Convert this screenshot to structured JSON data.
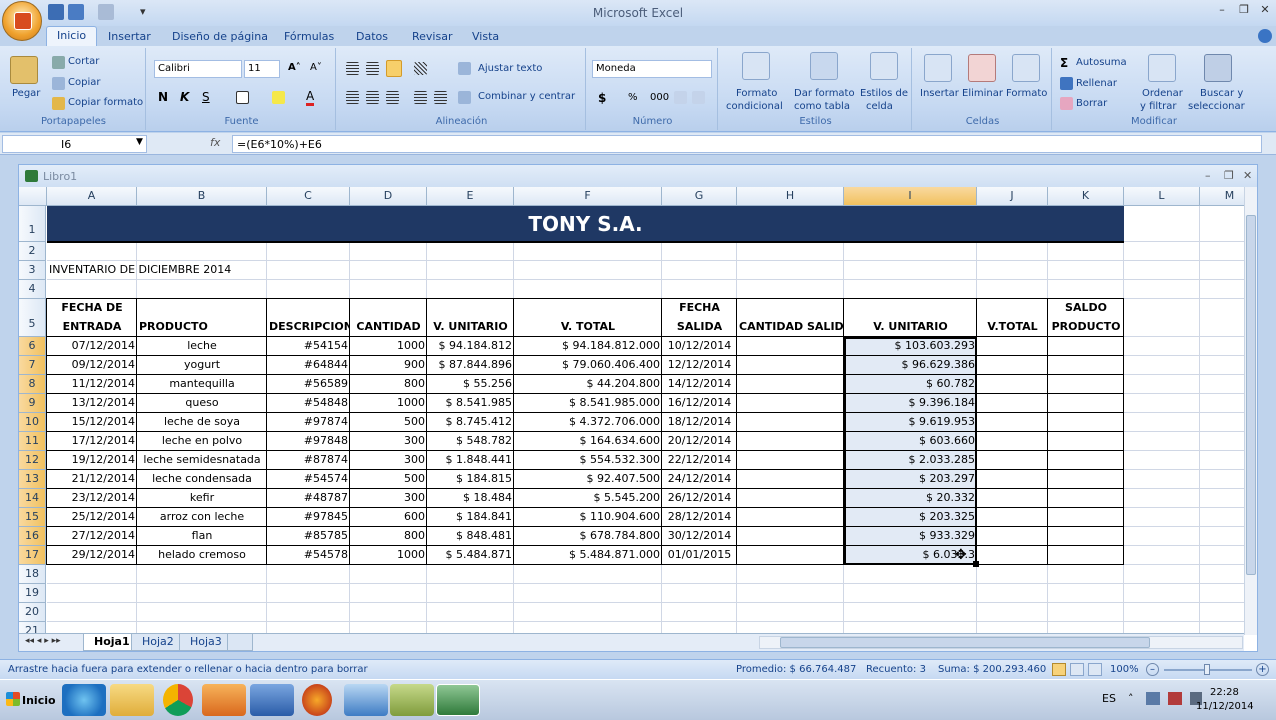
{
  "titlebar": {
    "app_title": "Microsoft Excel"
  },
  "tabs": [
    {
      "label": "Inicio"
    },
    {
      "label": "Insertar"
    },
    {
      "label": "Diseño de página"
    },
    {
      "label": "Fórmulas"
    },
    {
      "label": "Datos"
    },
    {
      "label": "Revisar"
    },
    {
      "label": "Vista"
    }
  ],
  "ribbon": {
    "portapapeles": {
      "label": "Portapapeles",
      "pegar": "Pegar",
      "cortar": "Cortar",
      "copiar": "Copiar",
      "copiar_formato": "Copiar formato"
    },
    "fuente": {
      "label": "Fuente",
      "font_name": "Calibri",
      "font_size": "11"
    },
    "alineacion": {
      "label": "Alineación",
      "ajustar_texto": "Ajustar texto",
      "combinar": "Combinar y centrar"
    },
    "numero": {
      "label": "Número",
      "format": "Moneda",
      "currency": "$",
      "percent": "%",
      "thousands": "000"
    },
    "estilos": {
      "label": "Estilos",
      "formato_condicional_1": "Formato",
      "formato_condicional_2": "condicional",
      "dar_formato_1": "Dar formato",
      "dar_formato_2": "como tabla",
      "estilos_celda_1": "Estilos de",
      "estilos_celda_2": "celda"
    },
    "celdas": {
      "label": "Celdas",
      "insertar": "Insertar",
      "eliminar": "Eliminar",
      "formato": "Formato"
    },
    "modificar": {
      "label": "Modificar",
      "autosuma": "Autosuma",
      "rellenar": "Rellenar",
      "borrar": "Borrar",
      "ordenar_1": "Ordenar",
      "ordenar_2": "y filtrar",
      "buscar_1": "Buscar y",
      "buscar_2": "seleccionar"
    }
  },
  "formula_bar": {
    "name_box": "I6",
    "fx": "fx",
    "formula": "=(E6*10%)+E6"
  },
  "workbook": {
    "title": "Libro1"
  },
  "columns": [
    "A",
    "B",
    "C",
    "D",
    "E",
    "F",
    "G",
    "H",
    "I",
    "J",
    "K",
    "L",
    "M"
  ],
  "rows": [
    "1",
    "2",
    "3",
    "4",
    "5",
    "6",
    "7",
    "8",
    "9",
    "10",
    "11",
    "12",
    "13",
    "14",
    "15",
    "16",
    "17",
    "18",
    "19",
    "20",
    "21"
  ],
  "sheet": {
    "banner": "TONY S.A.",
    "subtitle": "INVENTARIO DE DICIEMBRE 2014",
    "headers": {
      "fecha_entrada_1": "FECHA DE",
      "fecha_entrada_2": "ENTRADA",
      "producto": "PRODUCTO",
      "descripcion": "DESCRIPCION",
      "cantidad": "CANTIDAD",
      "v_unitario": "V. UNITARIO",
      "v_total": "V. TOTAL",
      "fecha_salida_1": "FECHA",
      "fecha_salida_2": "SALIDA",
      "cantidad_salida": "CANTIDAD SALIDA",
      "v_unitario_2": "V. UNITARIO",
      "v_total_2": "V.TOTAL",
      "saldo_1": "SALDO",
      "saldo_2": "PRODUCTO"
    },
    "data": [
      [
        "07/12/2014",
        "leche",
        "#54154",
        "1000",
        "$ 94.184.812",
        "$ 94.184.812.000",
        "10/12/2014",
        "$ 103.603.293"
      ],
      [
        "09/12/2014",
        "yogurt",
        "#64844",
        "900",
        "$ 87.844.896",
        "$ 79.060.406.400",
        "12/12/2014",
        "$ 96.629.386"
      ],
      [
        "11/12/2014",
        "mantequilla",
        "#56589",
        "800",
        "$ 55.256",
        "$ 44.204.800",
        "14/12/2014",
        "$ 60.782"
      ],
      [
        "13/12/2014",
        "queso",
        "#54848",
        "1000",
        "$ 8.541.985",
        "$ 8.541.985.000",
        "16/12/2014",
        "$ 9.396.184"
      ],
      [
        "15/12/2014",
        "leche de soya",
        "#97874",
        "500",
        "$ 8.745.412",
        "$ 4.372.706.000",
        "18/12/2014",
        "$ 9.619.953"
      ],
      [
        "17/12/2014",
        "leche en polvo",
        "#97848",
        "300",
        "$ 548.782",
        "$ 164.634.600",
        "20/12/2014",
        "$ 603.660"
      ],
      [
        "19/12/2014",
        "leche semidesnatada",
        "#87874",
        "300",
        "$ 1.848.441",
        "$ 554.532.300",
        "22/12/2014",
        "$ 2.033.285"
      ],
      [
        "21/12/2014",
        "leche condensada",
        "#54574",
        "500",
        "$ 184.815",
        "$ 92.407.500",
        "24/12/2014",
        "$ 203.297"
      ],
      [
        "23/12/2014",
        "kefir",
        "#48787",
        "300",
        "$ 18.484",
        "$ 5.545.200",
        "26/12/2014",
        "$ 20.332"
      ],
      [
        "25/12/2014",
        "arroz con leche",
        "#97845",
        "600",
        "$ 184.841",
        "$ 110.904.600",
        "28/12/2014",
        "$ 203.325"
      ],
      [
        "27/12/2014",
        "flan",
        "#85785",
        "800",
        "$ 848.481",
        "$ 678.784.800",
        "30/12/2014",
        "$ 933.329"
      ],
      [
        "29/12/2014",
        "helado cremoso",
        "#54578",
        "1000",
        "$ 5.484.871",
        "$ 5.484.871.000",
        "01/01/2015",
        "$ 6.033.3"
      ]
    ]
  },
  "sheet_tabs": [
    {
      "label": "Hoja1"
    },
    {
      "label": "Hoja2"
    },
    {
      "label": "Hoja3"
    }
  ],
  "status": {
    "message": "Arrastre hacia fuera para extender o rellenar o hacia dentro para borrar",
    "promedio": "Promedio: $ 66.764.487",
    "recuento": "Recuento: 3",
    "suma": "Suma: $ 200.293.460",
    "zoom": "100%"
  },
  "taskbar": {
    "start": "Inicio",
    "lang": "ES",
    "time": "22:28",
    "date": "11/12/2014"
  }
}
